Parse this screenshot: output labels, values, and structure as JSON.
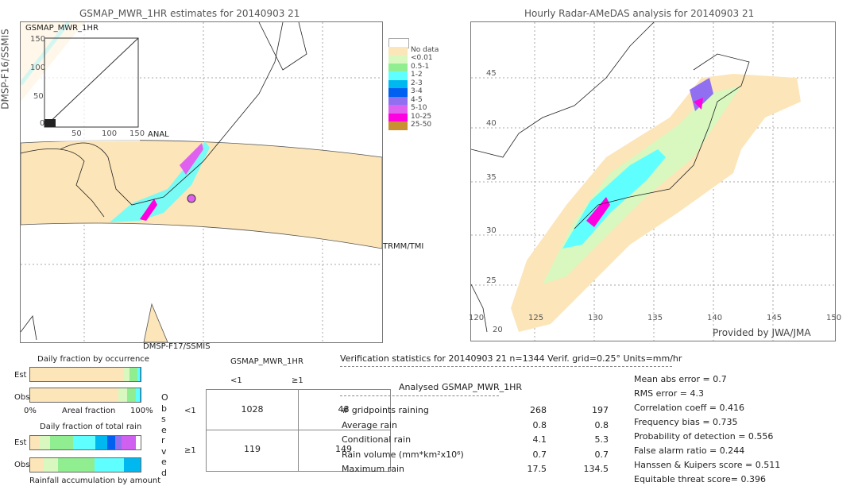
{
  "left_map": {
    "title": "GSMAP_MWR_1HR estimates for 20140903 21",
    "inset_label": "GSMAP_MWR_1HR",
    "inset_yticks": [
      "150",
      "100",
      "50",
      "0"
    ],
    "inset_xticks": [
      "0",
      "50",
      "100",
      "150"
    ],
    "inset_xlabel": "ANAL",
    "sensor_left": "DMSP-F16/SSMIS",
    "sensor_right": "TRMM/TMI",
    "sensor_bottom": "DMSP-F17/SSMIS"
  },
  "right_map": {
    "title": "Hourly Radar-AMeDAS analysis for 20140903 21",
    "lon_ticks": [
      "120",
      "125",
      "130",
      "135",
      "140",
      "145",
      "150"
    ],
    "lat_ticks": [
      "45",
      "40",
      "35",
      "30",
      "25",
      "20"
    ],
    "credit": "Provided by JWA/JMA"
  },
  "legend": [
    {
      "label": "",
      "color": "#ffffff"
    },
    {
      "label": "No data",
      "color": "#fce5b8"
    },
    {
      "label": "<0.01",
      "color": "#d8f8c0"
    },
    {
      "label": "0.5-1",
      "color": "#90ee90"
    },
    {
      "label": "1-2",
      "color": "#60ffff"
    },
    {
      "label": "2-3",
      "color": "#00b8f0"
    },
    {
      "label": "3-4",
      "color": "#0060f0"
    },
    {
      "label": "4-5",
      "color": "#9070f0"
    },
    {
      "label": "5-10",
      "color": "#e060f0"
    },
    {
      "label": "10-25",
      "color": "#ff00e0"
    },
    {
      "label": "25-50",
      "color": "#c89030"
    }
  ],
  "occurrence": {
    "title": "Daily fraction by occurrence",
    "est_label": "Est",
    "obs_label": "Obs",
    "xmin": "0%",
    "xlabel": "Areal fraction",
    "xmax": "100%",
    "est": [
      {
        "pct": 85,
        "color": "#fce5b8"
      },
      {
        "pct": 5,
        "color": "#d8f8c0"
      },
      {
        "pct": 7,
        "color": "#90ee90"
      },
      {
        "pct": 2,
        "color": "#60ffff"
      },
      {
        "pct": 1,
        "color": "#00b8f0"
      }
    ],
    "obs": [
      {
        "pct": 80,
        "color": "#fce5b8"
      },
      {
        "pct": 8,
        "color": "#d8f8c0"
      },
      {
        "pct": 8,
        "color": "#90ee90"
      },
      {
        "pct": 3,
        "color": "#60ffff"
      },
      {
        "pct": 1,
        "color": "#00b8f0"
      }
    ]
  },
  "total_rain": {
    "title": "Daily fraction of total rain",
    "est_label": "Est",
    "obs_label": "Obs",
    "xlabel": "Rainfall accumulation by amount",
    "est": [
      {
        "pct": 8,
        "color": "#fce5b8"
      },
      {
        "pct": 10,
        "color": "#d8f8c0"
      },
      {
        "pct": 21,
        "color": "#90ee90"
      },
      {
        "pct": 20,
        "color": "#60ffff"
      },
      {
        "pct": 11,
        "color": "#00b8f0"
      },
      {
        "pct": 7,
        "color": "#0060f0"
      },
      {
        "pct": 6,
        "color": "#9070f0"
      },
      {
        "pct": 13,
        "color": "#d060f0"
      }
    ],
    "obs": [
      {
        "pct": 12,
        "color": "#fce5b8"
      },
      {
        "pct": 13,
        "color": "#d8f8c0"
      },
      {
        "pct": 33,
        "color": "#90ee90"
      },
      {
        "pct": 27,
        "color": "#60ffff"
      },
      {
        "pct": 15,
        "color": "#00b8f0"
      }
    ]
  },
  "contingency": {
    "title": "GSMAP_MWR_1HR",
    "col_lt": "<1",
    "col_ge": "≥1",
    "row_lt": "<1",
    "row_ge": "≥1",
    "observed": [
      "O",
      "b",
      "s",
      "e",
      "r",
      "v",
      "e",
      "d"
    ],
    "cells": [
      "1028",
      "48",
      "119",
      "149"
    ]
  },
  "stats": {
    "header": "Verification statistics for 20140903 21   n=1344   Verif. grid=0.25°   Units=mm/hr",
    "col_analysed": "Analysed",
    "col_est": "GSMAP_MWR_1HR",
    "rows": [
      {
        "label": "# gridpoints raining",
        "a": "268",
        "e": "197"
      },
      {
        "label": "Average rain",
        "a": "0.8",
        "e": "0.8"
      },
      {
        "label": "Conditional rain",
        "a": "4.1",
        "e": "5.3"
      },
      {
        "label": "Rain volume (mm*km²x10⁶)",
        "a": "0.7",
        "e": "0.7"
      },
      {
        "label": "Maximum rain",
        "a": "17.5",
        "e": "134.5"
      }
    ],
    "scores": [
      "Mean abs error = 0.7",
      "RMS error = 4.3",
      "Correlation coeff = 0.416",
      "Frequency bias = 0.735",
      "Probability of detection = 0.556",
      "False alarm ratio = 0.244",
      "Hanssen & Kuipers score = 0.511",
      "Equitable threat score= 0.396"
    ]
  }
}
